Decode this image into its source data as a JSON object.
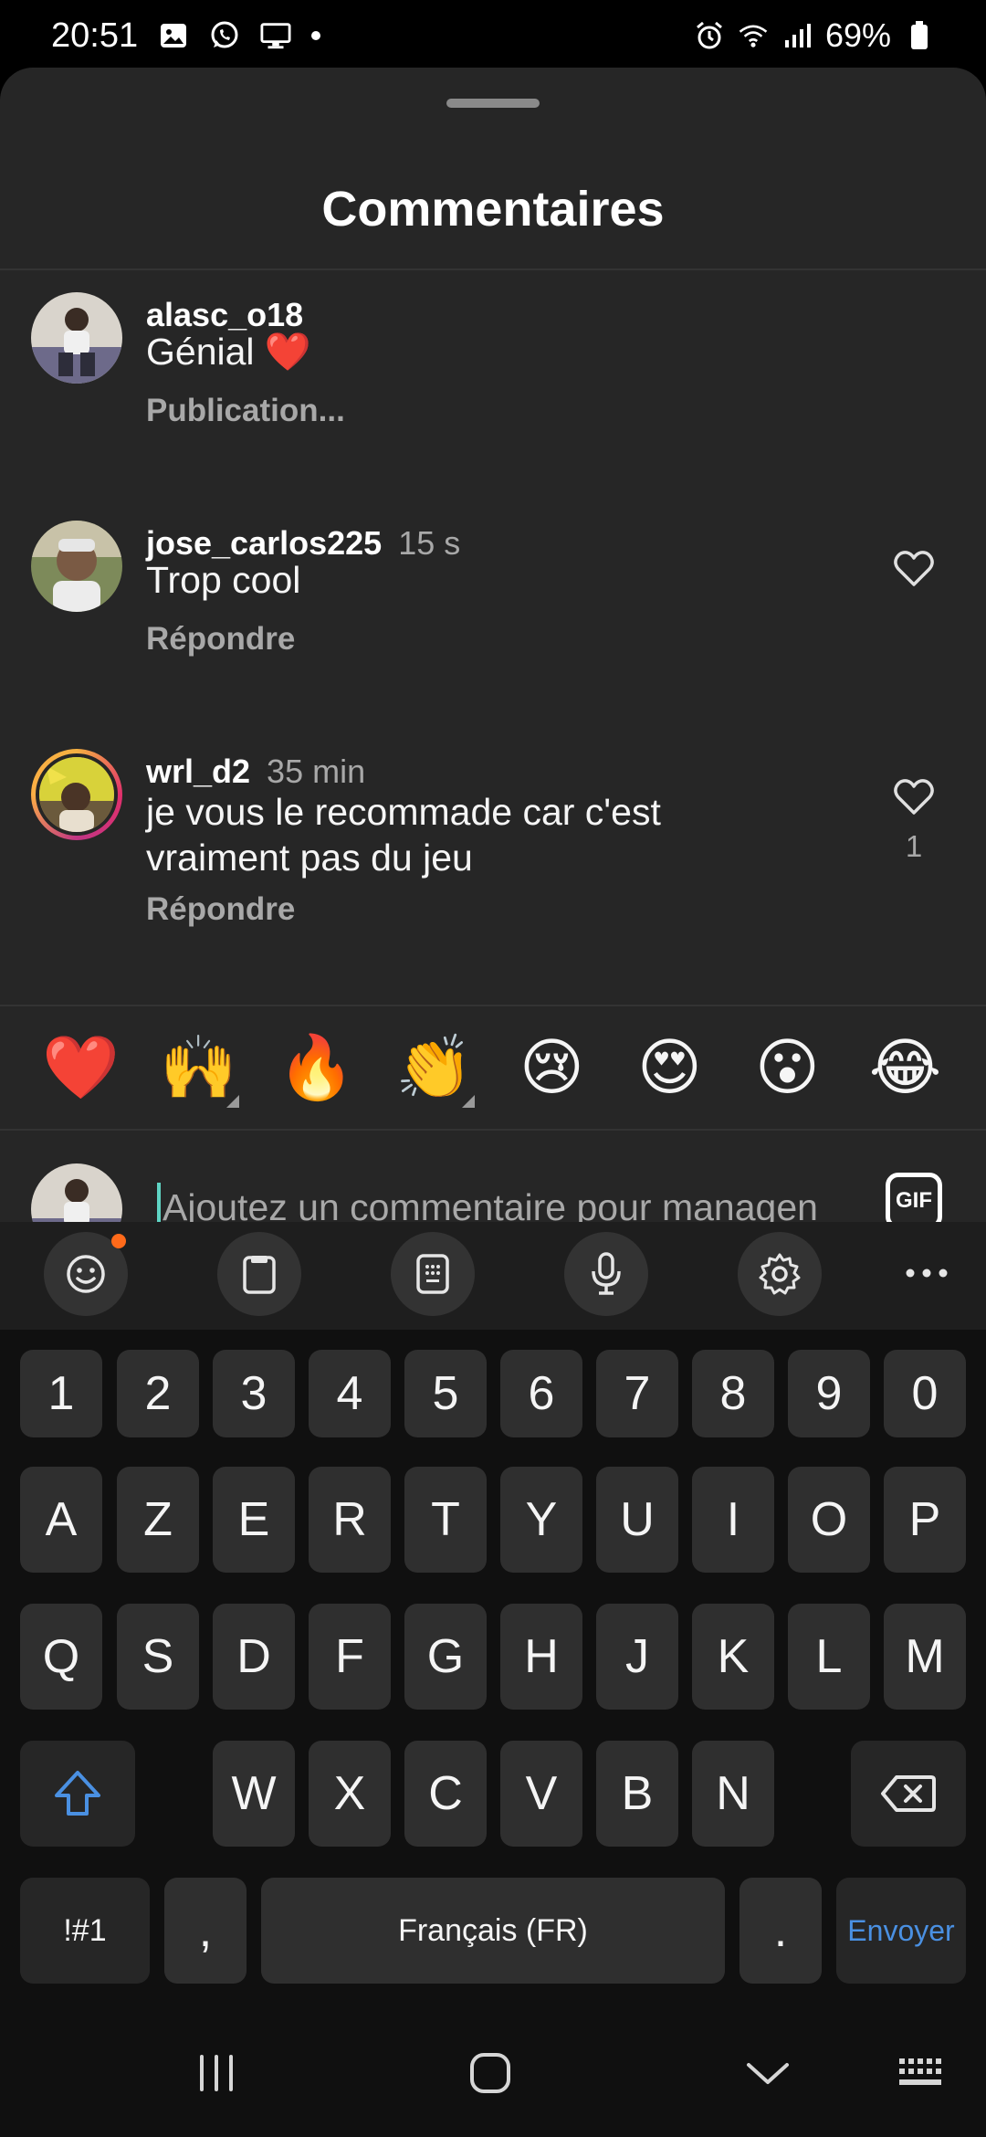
{
  "status_bar": {
    "time": "20:51",
    "battery": "69%",
    "left_icons": [
      "image-icon",
      "whatsapp-icon",
      "monitor-icon",
      "dot-icon"
    ],
    "right_icons": [
      "alarm-icon",
      "wifi-icon",
      "signal-icon",
      "battery-icon"
    ]
  },
  "sheet": {
    "title": "Commentaires"
  },
  "comments": [
    {
      "username": "alasc_o18",
      "time": "",
      "text": "Génial ❤️",
      "action": "Publication...",
      "likes": ""
    },
    {
      "username": "jose_carlos225",
      "time": "15 s",
      "text": "Trop cool",
      "action": "Répondre",
      "likes": ""
    },
    {
      "username": "wrl_d2",
      "time": "35 min",
      "text": "je vous le recommade car c'est vraiment pas du jeu",
      "action": "Répondre",
      "likes": "1"
    }
  ],
  "emoji_bar": [
    "❤️",
    "🙌",
    "🔥",
    "👏",
    "😢",
    "😍",
    "😮",
    "😂"
  ],
  "compose": {
    "placeholder": "Ajoutez un commentaire pour managen",
    "gif_label": "GIF"
  },
  "keyboard_toolbar": [
    "emoji-icon",
    "clipboard-icon",
    "keypad-icon",
    "microphone-icon",
    "settings-icon",
    "more-icon"
  ],
  "keyboard": {
    "row_numbers": [
      "1",
      "2",
      "3",
      "4",
      "5",
      "6",
      "7",
      "8",
      "9",
      "0"
    ],
    "row_1": [
      "A",
      "Z",
      "E",
      "R",
      "T",
      "Y",
      "U",
      "I",
      "O",
      "P"
    ],
    "row_2": [
      "Q",
      "S",
      "D",
      "F",
      "G",
      "H",
      "J",
      "K",
      "L",
      "M"
    ],
    "row_3": [
      "W",
      "X",
      "C",
      "V",
      "B",
      "N"
    ],
    "symbols_label": "!#1",
    "comma": ",",
    "space_label": "Français (FR)",
    "period": ".",
    "enter_label": "Envoyer"
  },
  "colors": {
    "sheet_background": "#262626",
    "cursor": "#5fd4c4",
    "enter_text": "#4a90e2",
    "shift_icon": "#4a90e2",
    "notification_dot": "#ff6a1a"
  }
}
